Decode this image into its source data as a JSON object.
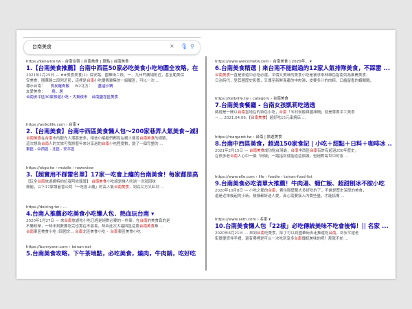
{
  "search": {
    "query": "台南美食"
  },
  "left": [
    {
      "url": "https://kenalice.tw › 台南住宿 | 台南美食 | 景點 | 台南美食",
      "title": "1.【台南美食推薦】台南中西區50家必吃美食小吃地圖全攻略，在 ...",
      "snippets": [
        "2021年1月25日 — ##美食美食(1): 保安路、國華街二段、一、九州門廣場附近，甚至範美保",
        "安美食、國華路二段附近區，這裡是台南小吃攤販聚集的一級戰區，可以一次 ..."
      ],
      "sub": [
        {
          "label": "標示台南：",
          "a": "良友羅肉飯",
          "b": "W2北方：",
          "c": "蓋滷沙鍋"
        },
        {
          "label": "友愛美食： ",
          "a": "鳥．居",
          "b": "",
          "c": ""
        }
      ],
      "sitelinks": [
        "台南安平區30家旅遊小吃・大東夜市",
        "台南鹽埕區美食"
      ]
    },
    {
      "url": "https://anikolife.com › 台南 ▾",
      "title": "2.【台南美食】台南中西區美食懶人包～200家巷弄人氣美食~減肥者摘 ...",
      "snippets": [
        "台南美食在台南市的觀光人潮甚是多，相信小編者們都有在網上搜尋台南美食的經驗，",
        "這次想為台南人的文旅可我將歷年來分享過的台南小吃程度數，變了一個完整的 ..."
      ],
      "sitelinks": [
        "東區 · 中西區 · 北區 · 安平區"
      ]
    },
    {
      "url": "https://okgo.tw › mobile › newsview",
      "title": "3.【超實用不踩雷名單】17家一吃會上癮的台南美食！每家都是高 ...",
      "snippets": [
        "【玩全台南旅遊網特約記者阿依報導】 台南美食小吃總是讓人吃過一次就回味",
        "無窮，以下17家讓者曾公認「一吃會上癮」的高人氣台南美食，到底又方又缸到 ..."
      ]
    },
    {
      "url": "https://deicing.tw › ...",
      "title": "4.台南人推薦必吃美食小吃懶人包．熱血玩台南 ▾",
      "snippets": [
        "2020年1月27日 — 來台南旅遊吃小吃已經是絕對必要的一件事，在台南的美食真的是",
        "不勝枚舉，一時半刻數要吃完也實在不容易，熱血此次大福四區這篇台南美食推 ...",
        "台南東區美食小吃 (回國文...  台南北區美食小吃・  台南東區美食小吃"
      ]
    },
    {
      "url": "https://bunnyann.com › tainan-eat",
      "title": "5.台南美食攻略，下午茶地點，必吃美食，燒肉，牛肉鍋，吃好吃",
      "snippets": []
    }
  ],
  "right": [
    {
      "url": "https://www.welcometw.com › 台南美食 | 2020年... ▾",
      "title": "6.台南美食精選 | 來台南不能錯過的12家人氣排隊美食，不踩雷 ...",
      "snippets": [
        "台南美食一直是旅遊中必吃必選，平價又美味的美食小吃是被求來林雄色指南列為推薦美食，",
        "日治時代，受其國歷史影響，又傳至新鮮海產的中肉湯，皮要多汁的肉粽，口齒留香的蝦類麵，"
      ]
    },
    {
      "url": "https://kellylife.tw › category › 台南美食",
      "title": "7.台南美食餐廳 - 台南女孩凱莉吃透透",
      "snippets": [
        "蔣經是一間以台南當地在的特色小吃，台南「五村炭飯與國雄鍋」就是專賣平工美食",
        "~ ... 2021.04.06.【台南美食】超好吃15元串燒店 ..."
      ]
    },
    {
      "url": "https://margaret.tw › 台南 | 旅遊美食",
      "title": "8.台南中西區美食，超過150家食記 | 小吃＋甜點＋日料＋咖啡冰 ...",
      "snippets": [
        "2021年2月15日 — 台南美食成功點台灣最，台南中西區台南有許有超過200年歷史，",
        "在很多老台南人心中一個「府城」一路指到就能道這個城，但絕對每世中的會 ..."
      ]
    },
    {
      "url": "https://www.elle.com › life › foodie › tainan-food-list",
      "title": "9.台南美食必吃清單大推薦！牛肉湯、蝦仁飯、超甜刨冰不胺小吃",
      "snippets": [
        "2020年10月8日 — 小吃之都的台南，賣住隔壁都大多好吃的了，不論是歷史深厚的美食，",
        "還是近來幾起的小新，樣樣都好送人愛，真心需要接入內費些量，才能搞嘴 ..."
      ]
    },
    {
      "url": "https://www.setn.com › 名家 ▾",
      "title": "10.台南美食懶人包「22樣」必吃傳統美味不吃會後悔！|| 名家 ...",
      "snippets": [
        "2020年6月21日 — 來到台南吃美食，除了可以到國華街去走推遊吃台南，到安平搶老",
        "街競便資伴手禮，還有哪裡是可以一次吃到享多台南傳統美味的呢？那就不妨 ..."
      ]
    }
  ],
  "highlights": [
    "台南美食",
    "台南"
  ],
  "colors": {
    "link": "#1a0dab",
    "highlight": "#c5221f",
    "snippet": "#4d5156"
  }
}
